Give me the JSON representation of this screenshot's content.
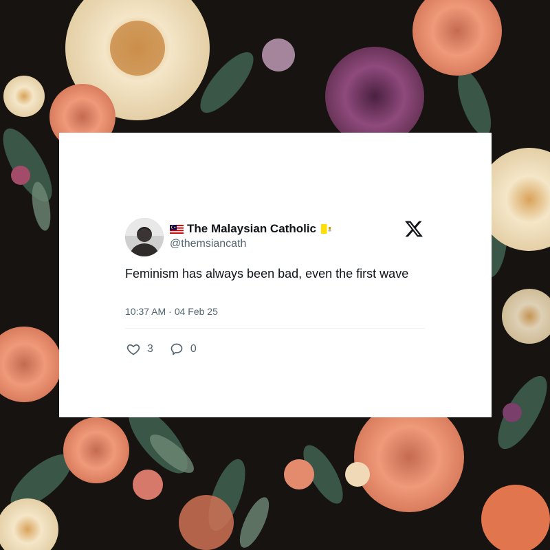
{
  "tweet": {
    "display_name": "The Malaysian Catholic",
    "handle": "@themsiancath",
    "text": "Feminism has always been bad, even the first wave",
    "time": "10:37 AM",
    "separator": "·",
    "date": "04 Feb 25",
    "likes": "3",
    "replies": "0",
    "avatar_icon": "avatar-photo",
    "name_prefix_icon": "malaysia-flag-icon",
    "name_suffix_icon": "vatican-flag-icon",
    "logo_icon": "x-logo-icon"
  },
  "actions": {
    "like_icon": "heart-icon",
    "reply_icon": "speech-bubble-icon"
  },
  "background": {
    "description_icon": "floral-pattern",
    "colors": [
      "#1a1613",
      "#e98f6f",
      "#f1e3c4",
      "#7a3f6a",
      "#3e5a4c"
    ]
  }
}
